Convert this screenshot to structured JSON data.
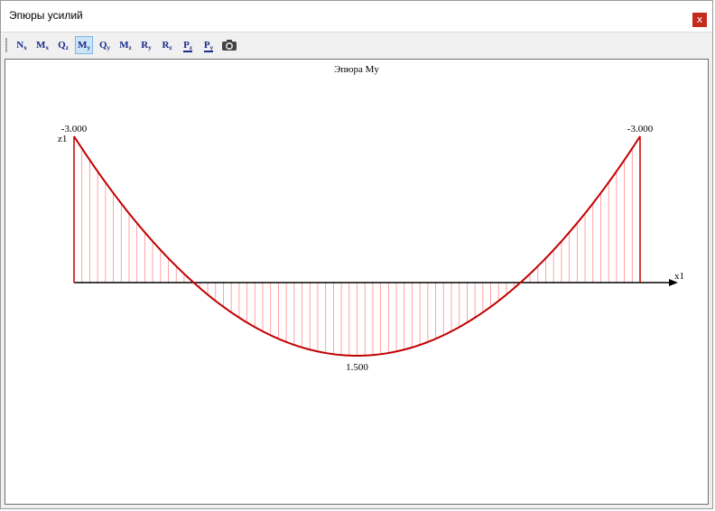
{
  "window": {
    "title": "Эпюры усилий",
    "close_label": "x"
  },
  "toolbar": {
    "buttons": [
      {
        "main": "N",
        "sub": "x",
        "active": false
      },
      {
        "main": "M",
        "sub": "x",
        "active": false
      },
      {
        "main": "Q",
        "sub": "z",
        "active": false
      },
      {
        "main": "M",
        "sub": "y",
        "active": true
      },
      {
        "main": "Q",
        "sub": "y",
        "active": false
      },
      {
        "main": "M",
        "sub": "z",
        "active": false
      },
      {
        "main": "R",
        "sub": "y",
        "active": false
      },
      {
        "main": "R",
        "sub": "z",
        "active": false
      },
      {
        "main": "P",
        "sub": "z",
        "active": false
      },
      {
        "main": "P",
        "sub": "y",
        "active": false
      }
    ],
    "camera_icon": "camera-icon"
  },
  "plot": {
    "title": "Эпюра My",
    "left_value": "-3.000",
    "right_value": "-3.000",
    "min_value": "1.500",
    "axis_label": "x1",
    "z_label": "z1",
    "colors": {
      "curve": "#c00000",
      "hatch": "#ff8c8c",
      "axis": "#000000"
    }
  },
  "chart_data": {
    "type": "line",
    "title": "Эпюра My",
    "series": [
      {
        "x": [
          0,
          0.5,
          1
        ],
        "y": [
          -3.0,
          1.5,
          -3.0
        ]
      }
    ],
    "annotations": [
      "-3.000",
      "1.500",
      "-3.000"
    ],
    "xlabel": "x1",
    "ylabel": "z1"
  }
}
